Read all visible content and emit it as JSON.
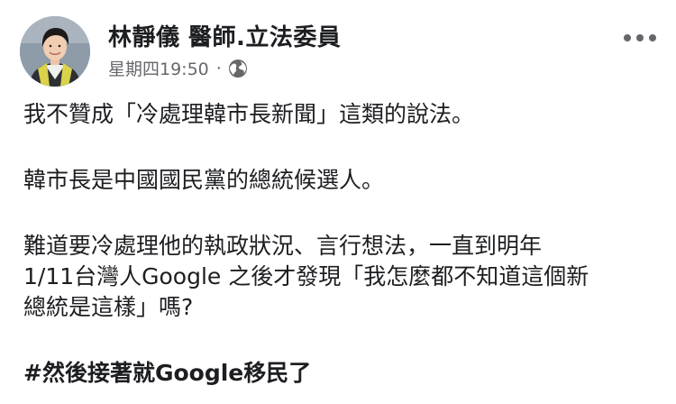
{
  "post": {
    "author_name": "林靜儀 醫師.立法委員",
    "timestamp": "星期四19:50",
    "separator": "·",
    "audience_icon": "globe-icon",
    "menu_icon": "more-horizontal-icon",
    "paragraphs": [
      "我不贊成「冷處理韓市長新聞」這類的說法。",
      "韓市長是中國國民黨的總統候選人。",
      "難道要冷處理他的執政狀況、言行想法，一直到明年\n1/11台灣人Google 之後才發現「我怎麼都不知道這個新\n總統是這樣」嗎?"
    ],
    "hashtag": "#然後接著就Google移民了"
  },
  "colors": {
    "text": "#1c1e21",
    "meta": "#65676b",
    "background": "#ffffff"
  }
}
